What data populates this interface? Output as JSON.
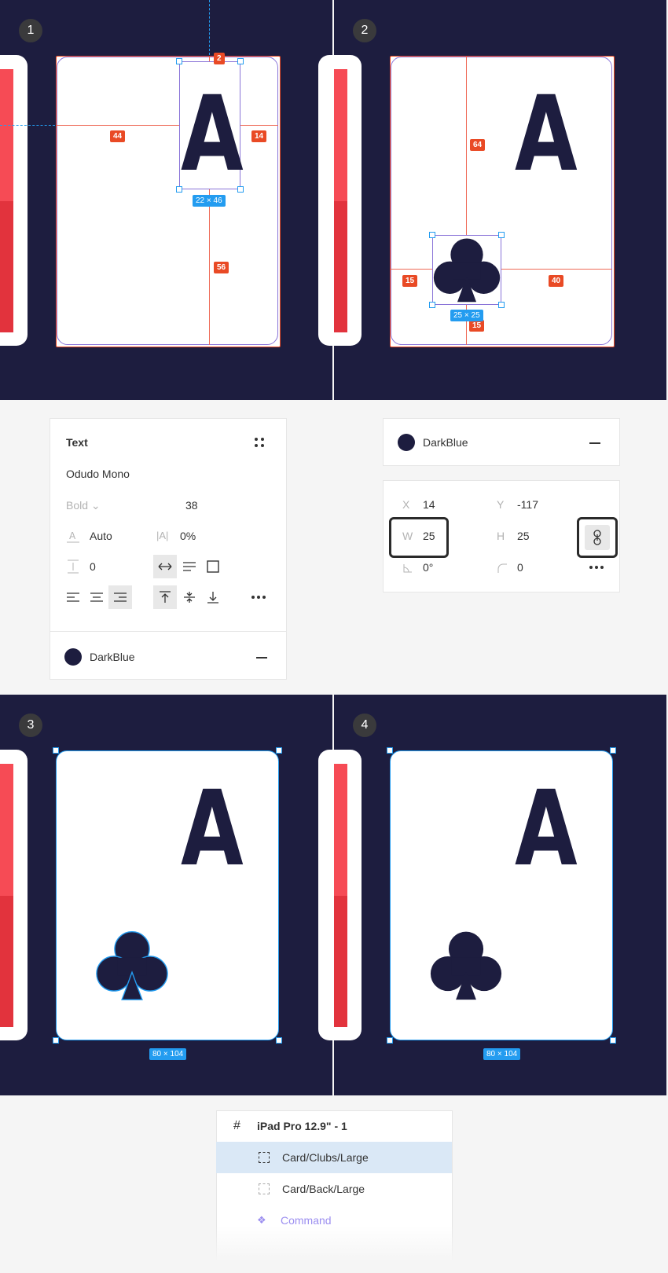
{
  "steps": [
    "1",
    "2",
    "3",
    "4"
  ],
  "panel1": {
    "measures": {
      "top": "2",
      "left": "44",
      "right": "14",
      "bottom": "56"
    },
    "size": "22 × 46",
    "card_letter": "A"
  },
  "panel2": {
    "measures": {
      "top": "64",
      "left": "15",
      "right": "40",
      "bottom": "15"
    },
    "size": "25 × 25",
    "card_letter": "A"
  },
  "panel3": {
    "card_letter": "A",
    "size": "80 × 104"
  },
  "panel4": {
    "card_letter": "A",
    "size": "80 × 104"
  },
  "text_panel": {
    "title": "Text",
    "font_family": "Odudo Mono",
    "font_weight": "Bold",
    "font_size": "38",
    "line_height": "Auto",
    "letter_spacing": "0%",
    "paragraph_spacing": "0",
    "fill_name": "DarkBlue"
  },
  "fill_panel": {
    "fill_name": "DarkBlue"
  },
  "transform_panel": {
    "x_label": "X",
    "x": "14",
    "y_label": "Y",
    "y": "-117",
    "w_label": "W",
    "w": "25",
    "h_label": "H",
    "h": "25",
    "rotation": "0°",
    "radius": "0"
  },
  "layers": {
    "frame": "iPad Pro 12.9\" - 1",
    "items": [
      "Card/Clubs/Large",
      "Card/Back/Large",
      "Command"
    ]
  },
  "colors": {
    "dark_blue": "#1d1d3f",
    "red_tag": "#e94a25",
    "blue_tag": "#239cf0",
    "back_red": "#f64b55"
  }
}
